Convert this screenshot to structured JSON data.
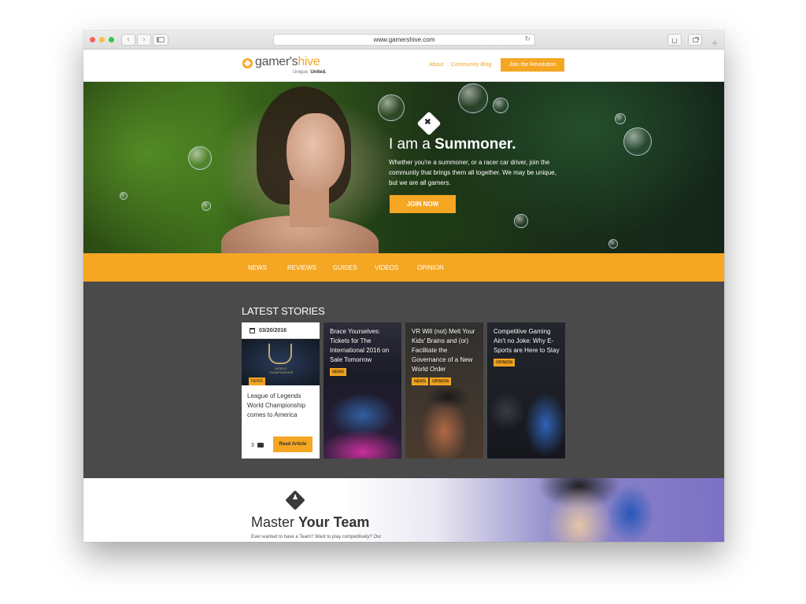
{
  "browser": {
    "url": "www.gamershive.com",
    "reload_glyph": "↻",
    "back_glyph": "‹",
    "forward_glyph": "›",
    "plus_glyph": "+"
  },
  "header": {
    "logo_word_1": "gamer's",
    "logo_word_2": "hive",
    "logo_tag_1": "Unique.",
    "logo_tag_2": "United.",
    "nav": {
      "about": "About",
      "blog": "Community Blog"
    },
    "cta": "Join the Revolution"
  },
  "hero": {
    "icon": "✖",
    "title_light": "I am a ",
    "title_bold": "Summoner.",
    "body": "Whether you're a summoner, or a racer car driver, join the community that brings them all together. We may be unique, but we are all gamers.",
    "button": "JOIN NOW"
  },
  "categories": [
    "NEWS",
    "REVIEWS",
    "GUIDES",
    "VIDEOS",
    "OPINION"
  ],
  "stories": {
    "title": "LATEST STORIES",
    "featured": {
      "date": "03/20/2016",
      "image_caption": "WORLD CHAMPIONSHIP",
      "tag": "NEWS",
      "title": "League of Legends World Championship comes to America",
      "comments": "3",
      "button": "Read Article"
    },
    "cards": [
      {
        "title": "Brace Yourselves: Tickets for The International 2016 on Sale Tomorrow",
        "tags": [
          "NEWS"
        ]
      },
      {
        "title": "VR Will (not) Melt Your Kids' Brains and (or) Facilitate the Governance of a New World Order",
        "tags": [
          "NEWS",
          "OPINION"
        ]
      },
      {
        "title": "Competitive Gaming Ain't no Joke: Why E-Sports are Here to Stay",
        "tags": [
          "OPINION"
        ]
      }
    ]
  },
  "team": {
    "icon": "♟",
    "title_light": "Master ",
    "title_bold": "Your Team",
    "body": "Ever wanted to have a Team? Want to play competitively? Our"
  },
  "colors": {
    "accent": "#f5a623",
    "stories_bg": "#4a4a4a"
  }
}
